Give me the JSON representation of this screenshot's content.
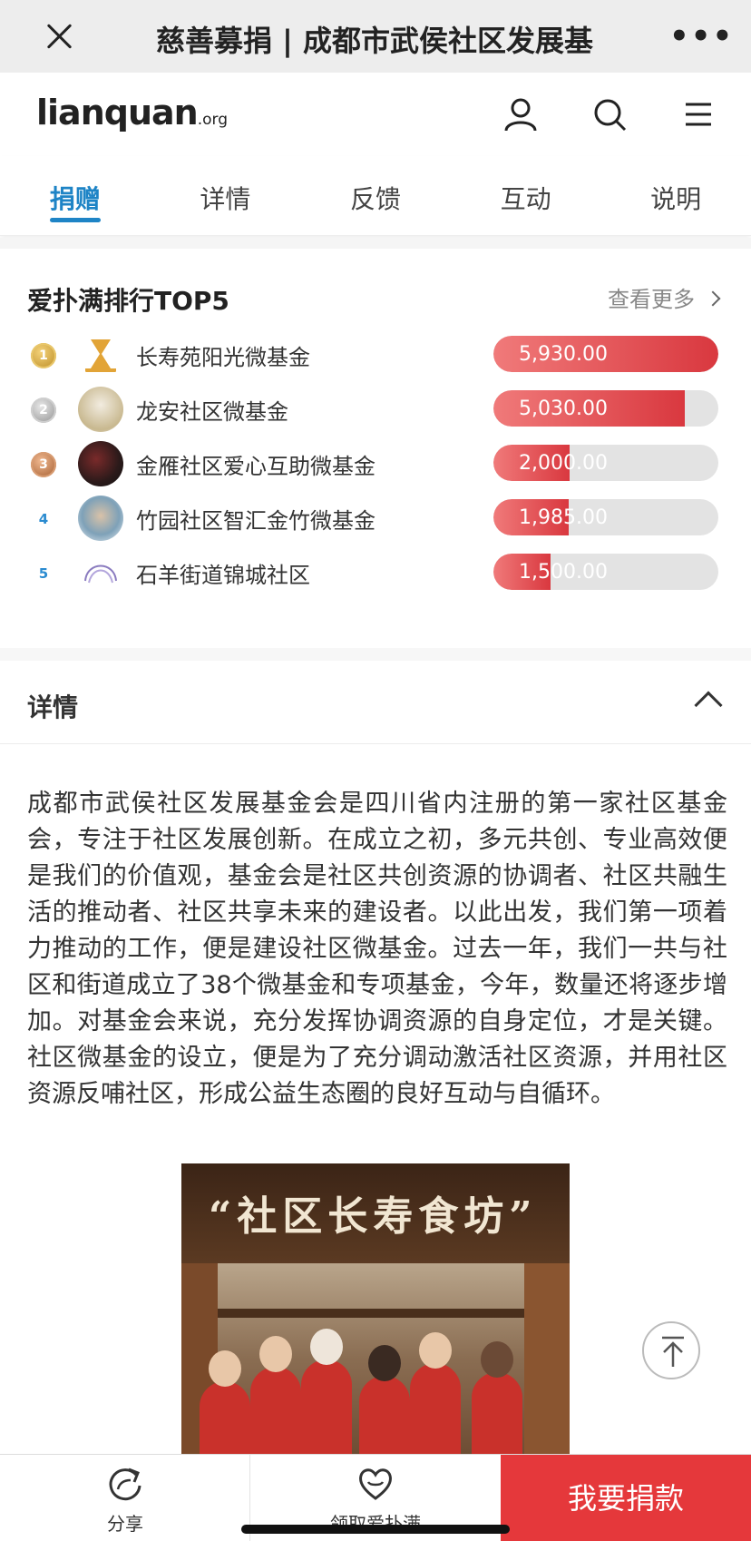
{
  "topbar": {
    "title": "慈善募捐 | 成都市武侯社区发展基"
  },
  "header": {
    "logo_main": "lianquan",
    "logo_suffix": ".org"
  },
  "tabs": [
    {
      "label": "捐赠",
      "active": true
    },
    {
      "label": "详情",
      "active": false
    },
    {
      "label": "反馈",
      "active": false
    },
    {
      "label": "互动",
      "active": false
    },
    {
      "label": "说明",
      "active": false
    }
  ],
  "ranking": {
    "title": "爱扑满排行TOP5",
    "more_label": "查看更多",
    "items": [
      {
        "rank": "1",
        "name": "长寿苑阳光微基金",
        "amount": "5,930.00",
        "progress": 1.0
      },
      {
        "rank": "2",
        "name": "龙安社区微基金",
        "amount": "5,030.00",
        "progress": 0.85
      },
      {
        "rank": "3",
        "name": "金雁社区爱心互助微基金",
        "amount": "2,000.00",
        "progress": 0.34
      },
      {
        "rank": "4",
        "name": "竹园社区智汇金竹微基金",
        "amount": "1,985.00",
        "progress": 0.335
      },
      {
        "rank": "5",
        "name": "石羊街道锦城社区",
        "amount": "1,500.00",
        "progress": 0.255
      }
    ]
  },
  "details": {
    "title": "详情",
    "body": "成都市武侯社区发展基金会是四川省内注册的第一家社区基金会，专注于社区发展创新。在成立之初，多元共创、专业高效便是我们的价值观，基金会是社区共创资源的协调者、社区共融生活的推动者、社区共享未来的建设者。以此出发，我们第一项着力推动的工作，便是建设社区微基金。过去一年，我们一共与社区和街道成立了38个微基金和专项基金，今年，数量还将逐步增加。对基金会来说，充分发挥协调资源的自身定位，才是关键。社区微基金的设立，便是为了充分调动激活社区资源，并用社区资源反哺社区，形成公益生态圈的良好互动与自循环。",
    "photo_sign": "“社区长寿食坊”"
  },
  "bottombar": {
    "share_label": "分享",
    "claim_label": "领取爱扑满",
    "donate_label": "我要捐款"
  },
  "colors": {
    "accent": "#1e84c6",
    "donate": "#e5383b",
    "bar_fill": "#d9383f",
    "bar_track": "#e3e3e3"
  }
}
